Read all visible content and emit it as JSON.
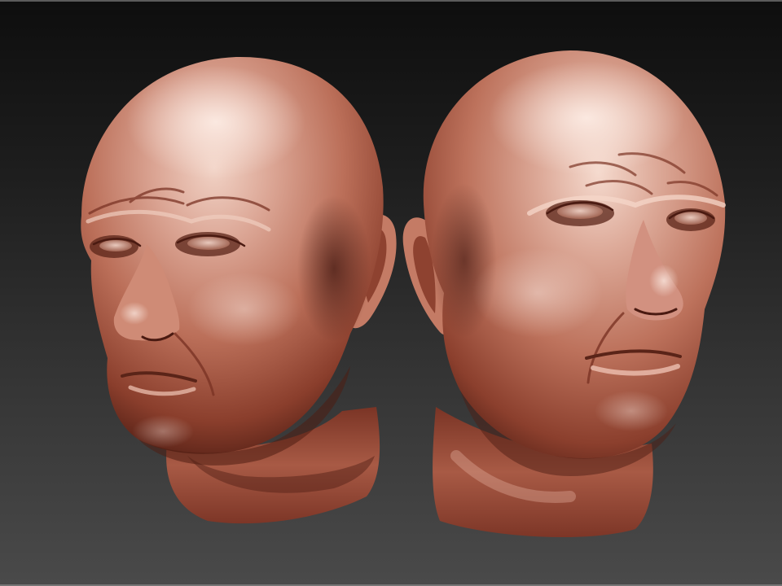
{
  "scene": {
    "subject_left": "sculpted-head-left",
    "subject_right": "sculpted-head-right"
  },
  "colors": {
    "background_top": "#0e0e0e",
    "background_bottom": "#4a4a4a",
    "clay_highlight": "#f2d3c6",
    "clay_light": "#d8a08d",
    "clay_mid": "#b86a55",
    "clay_shadow": "#6d2f20",
    "clay_deep": "#3d1610"
  }
}
